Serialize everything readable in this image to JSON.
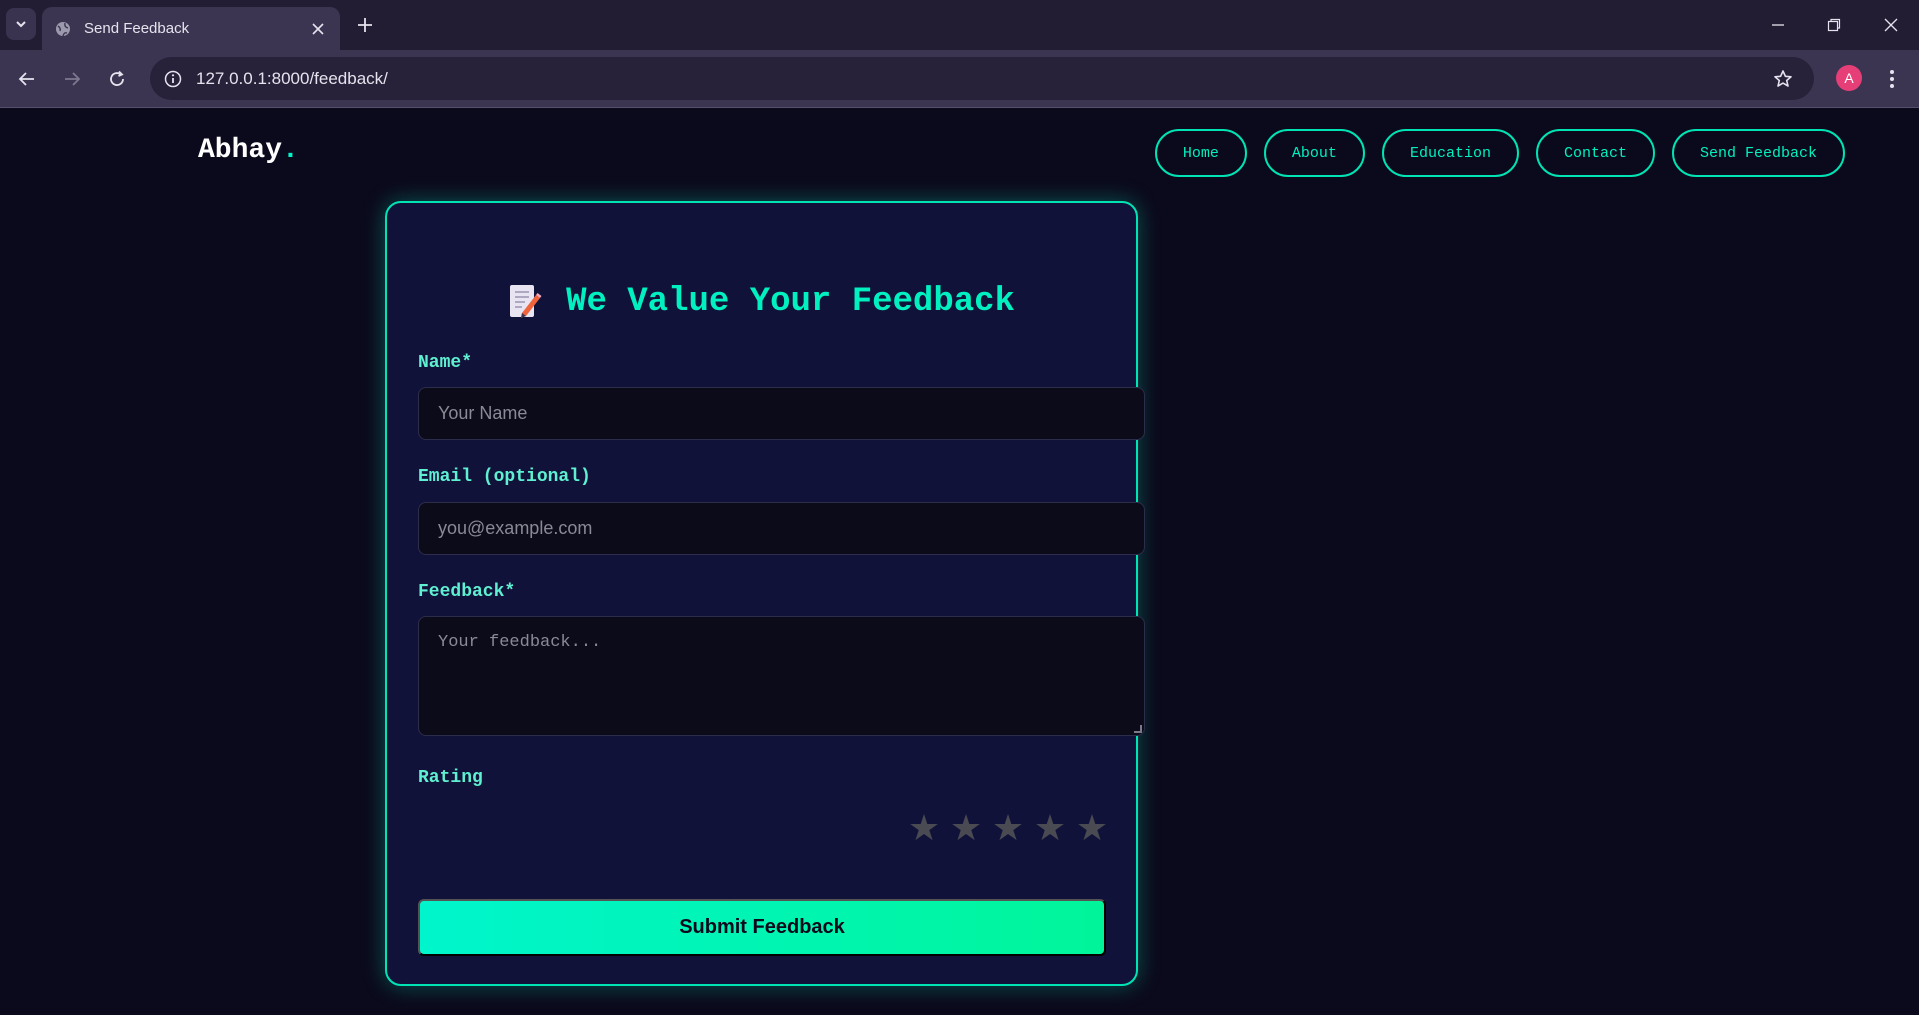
{
  "browser": {
    "tab_title": "Send Feedback",
    "url": "127.0.0.1:8000/feedback/",
    "profile_initial": "A"
  },
  "site": {
    "logo_text": "Abhay",
    "logo_dot": ".",
    "nav": [
      {
        "label": "Home"
      },
      {
        "label": "About"
      },
      {
        "label": "Education"
      },
      {
        "label": "Contact"
      },
      {
        "label": "Send Feedback"
      }
    ]
  },
  "form": {
    "title": "We Value Your Feedback",
    "title_icon": "memo-icon",
    "name_label": "Name*",
    "name_placeholder": "Your Name",
    "email_label": "Email (optional)",
    "email_placeholder": "you@example.com",
    "feedback_label": "Feedback*",
    "feedback_placeholder": "Your feedback...",
    "rating_label": "Rating",
    "rating_max": 5,
    "rating_value": 0,
    "submit_label": "Submit Feedback"
  },
  "colors": {
    "accent": "#00e3b4",
    "page_bg": "#0b0a1c",
    "card_bg": "#11123a",
    "star_inactive": "#4a4a52"
  }
}
